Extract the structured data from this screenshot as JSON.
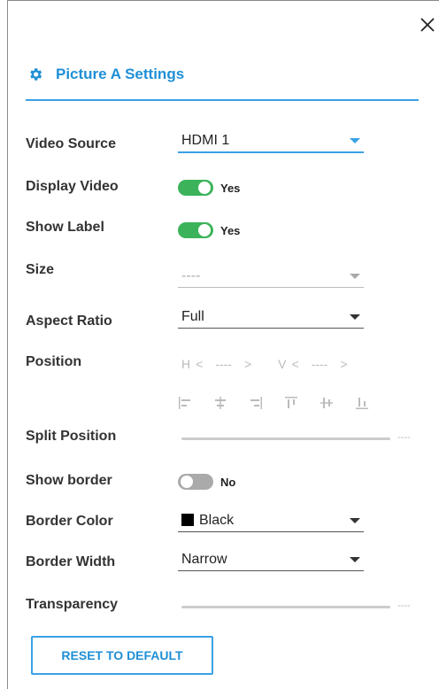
{
  "panel": {
    "title": "Picture A Settings",
    "close_icon": "close-icon",
    "accent_color": "#1f8fd6",
    "toggle_on_color": "#3cb35a"
  },
  "fields": {
    "video_source": {
      "label": "Video Source",
      "value": "HDMI 1"
    },
    "display_video": {
      "label": "Display Video",
      "state": "Yes"
    },
    "show_label": {
      "label": "Show Label",
      "state": "Yes"
    },
    "size": {
      "label": "Size",
      "value": "----"
    },
    "aspect_ratio": {
      "label": "Aspect Ratio",
      "value": "Full"
    },
    "position": {
      "label": "Position",
      "h_label": "H",
      "h_value": "----",
      "v_label": "V",
      "v_value": "----",
      "prev": "<",
      "next": ">"
    },
    "split_position": {
      "label": "Split Position",
      "value": "----"
    },
    "show_border": {
      "label": "Show border",
      "state": "No"
    },
    "border_color": {
      "label": "Border Color",
      "value": "Black"
    },
    "border_width": {
      "label": "Border Width",
      "value": "Narrow"
    },
    "transparency": {
      "label": "Transparency",
      "value": "----"
    }
  },
  "actions": {
    "reset_label": "RESET TO DEFAULT"
  }
}
